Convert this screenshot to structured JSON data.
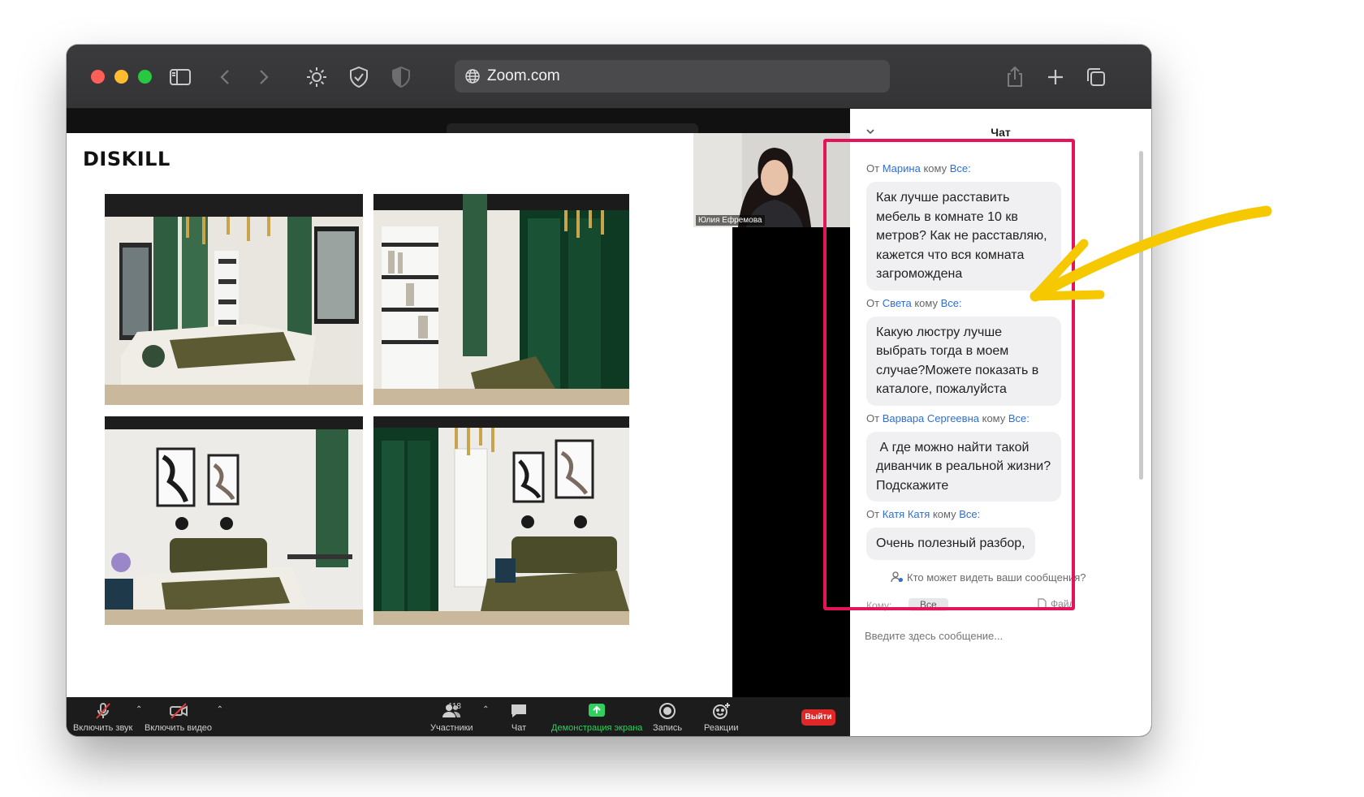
{
  "browser": {
    "url": "Zoom.com"
  },
  "slide": {
    "logo": "DISKILL"
  },
  "speaker": {
    "name": "Юлия Ефремова"
  },
  "toolbar": {
    "mute_label": "Включить звук",
    "video_label": "Включить видео",
    "participants_label": "Участники",
    "participants_count": "118",
    "chat_label": "Чат",
    "share_label": "Демонстрация экрана",
    "record_label": "Запись",
    "reactions_label": "Реакции",
    "leave_label": "Выйти"
  },
  "chat": {
    "title": "Чат",
    "messages": [
      {
        "from_prefix": "От",
        "sender": "Марина",
        "to_word": "кому",
        "recipient": "Все:",
        "text": "Как лучше расставить мебель в комнате 10 кв метров? Как не расставляю, кажется что вся комната загромождена"
      },
      {
        "from_prefix": "От",
        "sender": "Света",
        "to_word": "кому",
        "recipient": "Все:",
        "text": "Какую люстру лучше выбрать тогда в моем случае?Можете показать в каталоге, пожалуйста"
      },
      {
        "from_prefix": "От",
        "sender": "Варвара Сергеевна",
        "to_word": "кому",
        "recipient": "Все:",
        "text": " А где можно найти такой диванчик в реальной жизни? Подскажите"
      },
      {
        "from_prefix": "От",
        "sender": "Катя Катя",
        "to_word": "кому",
        "recipient": "Все:",
        "text": "Очень полезный разбор,"
      }
    ],
    "visibility_note": "Кто может видеть ваши сообщения?",
    "to_label": "Кому:",
    "to_value": "Все",
    "file_label": "Файл",
    "input_placeholder": "Введите здесь сообщение..."
  },
  "colors": {
    "highlight": "#e4145a",
    "arrow": "#f5c800",
    "link": "#2c6fd6",
    "share_green": "#2fd05e",
    "leave_red": "#e02828"
  }
}
